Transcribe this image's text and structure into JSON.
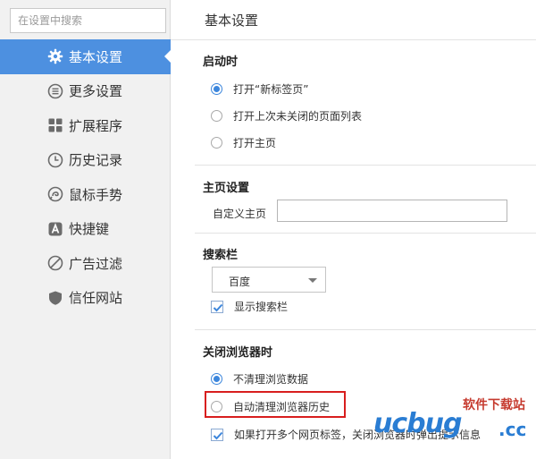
{
  "sidebar": {
    "search_placeholder": "在设置中搜索",
    "items": [
      {
        "label": "基本设置",
        "icon": "gear-icon",
        "active": true
      },
      {
        "label": "更多设置",
        "icon": "list-icon"
      },
      {
        "label": "扩展程序",
        "icon": "grid-icon"
      },
      {
        "label": "历史记录",
        "icon": "clock-icon"
      },
      {
        "label": "鼠标手势",
        "icon": "mouse-gesture-icon"
      },
      {
        "label": "快捷键",
        "icon": "keyboard-a-icon"
      },
      {
        "label": "广告过滤",
        "icon": "block-icon"
      },
      {
        "label": "信任网站",
        "icon": "shield-icon"
      }
    ]
  },
  "main": {
    "title": "基本设置",
    "startup": {
      "heading": "启动时",
      "options": [
        "打开“新标签页”",
        "打开上次未关闭的页面列表",
        "打开主页"
      ],
      "selected_index": 0
    },
    "homepage": {
      "heading": "主页设置",
      "custom_label": "自定义主页",
      "value": ""
    },
    "searchbar": {
      "heading": "搜索栏",
      "engine": "百度",
      "show_label": "显示搜索栏",
      "show_checked": true
    },
    "close": {
      "heading": "关闭浏览器时",
      "options": [
        "不清理浏览数据",
        "自动清理浏览器历史"
      ],
      "selected_index": 0,
      "confirm_label": "如果打开多个网页标签，关闭浏览器时弹出提示信息",
      "confirm_checked": true
    }
  },
  "watermark": {
    "cn": "软件下载站",
    "brand": "ucbug",
    "tld": ".cc"
  },
  "colors": {
    "accent": "#4d90e0",
    "highlight": "#d81e1e",
    "watermark_blue": "#2a7dd3",
    "watermark_red": "#c63b2f"
  }
}
